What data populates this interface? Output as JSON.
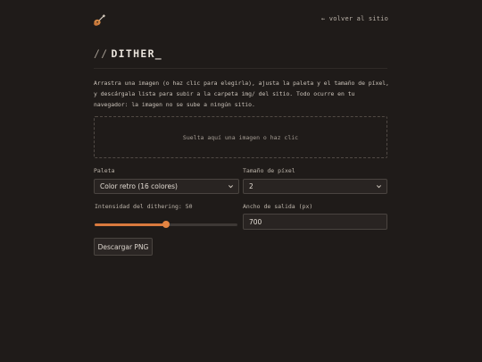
{
  "header": {
    "logo_icon": "guitar-icon",
    "back_link": "← volver al sitio"
  },
  "title": {
    "prefix": "//",
    "text": "DITHER_"
  },
  "intro": "Arrastra una imagen (o haz clic para elegirla), ajusta la paleta y el tamaño de píxel, y descárgala lista para subir a la carpeta img/ del sitio. Todo ocurre en tu navegador: la imagen no se sube a ningún sitio.",
  "dropzone": {
    "text": "Suelta aquí una imagen o haz clic"
  },
  "controls": {
    "palette": {
      "label": "Paleta",
      "selected": "Color retro (16 colores)"
    },
    "pixel_size": {
      "label": "Tamaño de píxel",
      "selected": "2"
    },
    "dithering": {
      "label_prefix": "Intensidad del dithering:",
      "value": "50",
      "fraction": 0.5
    },
    "output_width": {
      "label": "Ancho de salida (px)",
      "value": "700"
    }
  },
  "download_button": "Descargar PNG",
  "colors": {
    "background": "#1f1b19",
    "accent": "#d97a3e"
  }
}
